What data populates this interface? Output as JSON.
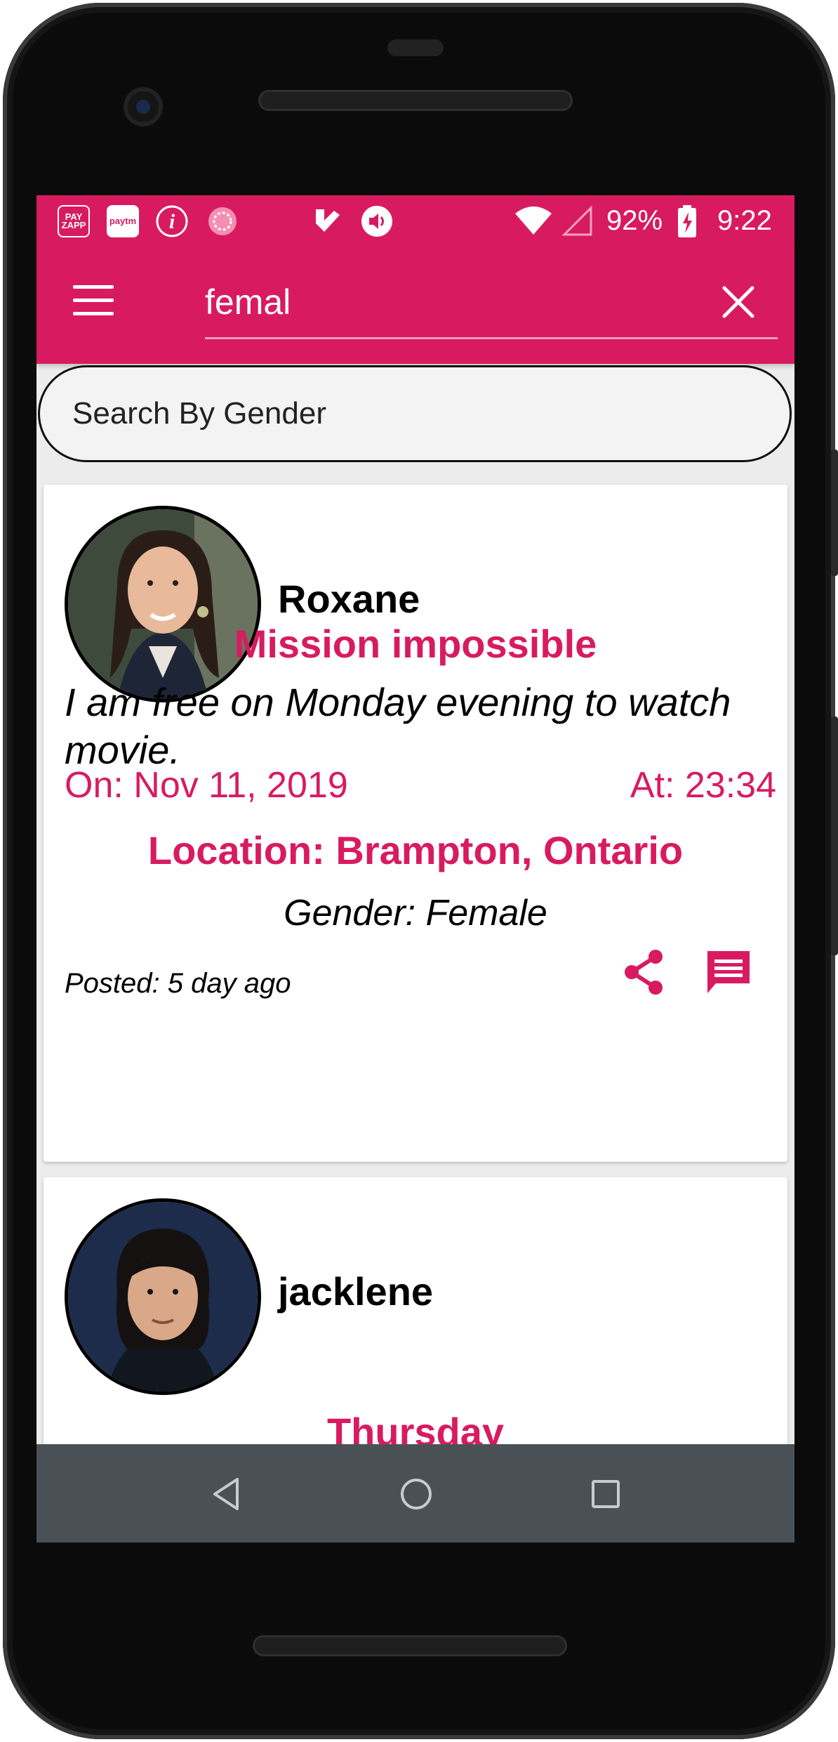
{
  "status_bar": {
    "icons": [
      "payzapp-icon",
      "paytm-icon",
      "imobile-icon",
      "sync-app-icon",
      "vote-check-icon",
      "volume-icon",
      "wifi-icon",
      "cell-signal-icon",
      "battery-charging-icon"
    ],
    "payzapp_label": "PAY ZAPP",
    "paytm_label": "paytm",
    "battery_percent": "92%",
    "time": "9:22"
  },
  "toolbar": {
    "menu_icon": "hamburger-menu-icon",
    "search_query": "femal",
    "close_icon": "close-icon",
    "background_color": "#d81b60"
  },
  "search_mode": {
    "label": "Search By Gender"
  },
  "posts": [
    {
      "user_name": "Roxane",
      "title": "Mission impossible",
      "description": "I am free on Monday evening to watch movie.",
      "date": "On: Nov 11, 2019",
      "time": "At: 23:34",
      "location": "Location: Brampton, Ontario",
      "gender": "Gender: Female",
      "posted": "Posted: 5 day ago",
      "share_icon": "share-icon",
      "message_icon": "message-icon"
    },
    {
      "user_name": "jacklene",
      "title": "Thursday"
    }
  ],
  "nav_bar": {
    "back_icon": "back-triangle-icon",
    "home_icon": "home-circle-icon",
    "recents_icon": "recents-square-icon"
  },
  "colors": {
    "accent": "#d81b60",
    "nav_bar": "#4a5156"
  }
}
